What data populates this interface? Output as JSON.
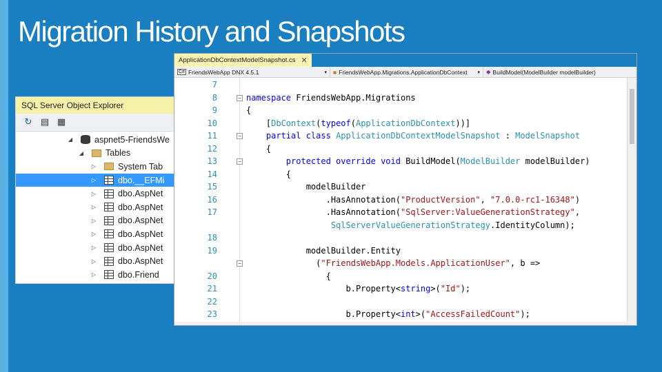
{
  "slide": {
    "title": "Migration History and Snapshots"
  },
  "object_explorer": {
    "title": "SQL Server Object Explorer",
    "toolbar_icons": [
      "refresh-icon",
      "filter-icon",
      "new-query-icon"
    ],
    "tree": [
      {
        "label": "aspnet5-FriendsWe",
        "icon": "database-icon",
        "expanded": true,
        "selected": false
      },
      {
        "label": "Tables",
        "icon": "folder-icon",
        "expanded": true,
        "selected": false
      },
      {
        "label": "System Tab",
        "icon": "folder-icon",
        "expanded": false,
        "selected": false
      },
      {
        "label": "dbo.__EFMi",
        "icon": "table-icon",
        "expanded": false,
        "selected": true
      },
      {
        "label": "dbo.AspNet",
        "icon": "table-icon",
        "expanded": false,
        "selected": false
      },
      {
        "label": "dbo.AspNet",
        "icon": "table-icon",
        "expanded": false,
        "selected": false
      },
      {
        "label": "dbo.AspNet",
        "icon": "table-icon",
        "expanded": false,
        "selected": false
      },
      {
        "label": "dbo.AspNet",
        "icon": "table-icon",
        "expanded": false,
        "selected": false
      },
      {
        "label": "dbo.AspNet",
        "icon": "table-icon",
        "expanded": false,
        "selected": false
      },
      {
        "label": "dbo.AspNet",
        "icon": "table-icon",
        "expanded": false,
        "selected": false
      },
      {
        "label": "dbo.Friend",
        "icon": "table-icon",
        "expanded": false,
        "selected": false
      }
    ]
  },
  "editor": {
    "tab_label": "ApplicationDbContextModelSnapshot.cs",
    "nav": {
      "project": "FriendsWebApp DNX 4.5.1",
      "class": "FriendsWebApp.Migrations.ApplicationDbContext",
      "member": "BuildModel(ModelBuilder modelBuilder)"
    },
    "code_lines": [
      {
        "num": "7",
        "fold": false,
        "wrap": false,
        "segments": []
      },
      {
        "num": "8",
        "fold": true,
        "wrap": false,
        "segments": [
          {
            "t": "namespace",
            "c": "kw"
          },
          {
            "t": " FriendsWebApp.Migrations",
            "c": ""
          }
        ]
      },
      {
        "num": "9",
        "fold": false,
        "wrap": false,
        "segments": [
          {
            "t": "{",
            "c": ""
          }
        ]
      },
      {
        "num": "10",
        "fold": false,
        "wrap": false,
        "segments": [
          {
            "t": "    [",
            "c": ""
          },
          {
            "t": "DbContext",
            "c": "ty"
          },
          {
            "t": "(",
            "c": ""
          },
          {
            "t": "typeof",
            "c": "kw"
          },
          {
            "t": "(",
            "c": ""
          },
          {
            "t": "ApplicationDbContext",
            "c": "ty"
          },
          {
            "t": "))]",
            "c": ""
          }
        ]
      },
      {
        "num": "11",
        "fold": true,
        "wrap": false,
        "segments": [
          {
            "t": "    ",
            "c": ""
          },
          {
            "t": "partial class",
            "c": "kw"
          },
          {
            "t": " ",
            "c": ""
          },
          {
            "t": "ApplicationDbContextModelSnapshot",
            "c": "ty"
          },
          {
            "t": " : ",
            "c": ""
          },
          {
            "t": "ModelSnapshot",
            "c": "ty"
          }
        ]
      },
      {
        "num": "12",
        "fold": false,
        "wrap": false,
        "segments": [
          {
            "t": "    {",
            "c": ""
          }
        ]
      },
      {
        "num": "13",
        "fold": true,
        "wrap": false,
        "segments": [
          {
            "t": "        ",
            "c": ""
          },
          {
            "t": "protected override void",
            "c": "kw"
          },
          {
            "t": " BuildModel(",
            "c": ""
          },
          {
            "t": "ModelBuilder",
            "c": "ty"
          },
          {
            "t": " modelBuilder)",
            "c": ""
          }
        ]
      },
      {
        "num": "14",
        "fold": false,
        "wrap": false,
        "segments": [
          {
            "t": "        {",
            "c": ""
          }
        ]
      },
      {
        "num": "15",
        "fold": false,
        "wrap": false,
        "segments": [
          {
            "t": "            modelBuilder",
            "c": ""
          }
        ]
      },
      {
        "num": "16",
        "fold": false,
        "wrap": false,
        "segments": [
          {
            "t": "                .HasAnnotation(",
            "c": ""
          },
          {
            "t": "\"ProductVersion\"",
            "c": "st"
          },
          {
            "t": ", ",
            "c": ""
          },
          {
            "t": "\"7.0.0-rc1-16348\"",
            "c": "st"
          },
          {
            "t": ")",
            "c": ""
          }
        ]
      },
      {
        "num": "17",
        "fold": false,
        "wrap": true,
        "segments": [
          {
            "t": "                .HasAnnotation(",
            "c": ""
          },
          {
            "t": "\"SqlServer:ValueGenerationStrategy\"",
            "c": "st"
          },
          {
            "t": ",",
            "c": ""
          }
        ]
      },
      {
        "num": "",
        "fold": false,
        "wrap": false,
        "segments": [
          {
            "t": "                 ",
            "c": ""
          },
          {
            "t": "SqlServerValueGenerationStrategy",
            "c": "ty"
          },
          {
            "t": ".IdentityColumn);",
            "c": ""
          }
        ]
      },
      {
        "num": "18",
        "fold": false,
        "wrap": false,
        "segments": []
      },
      {
        "num": "19",
        "fold": false,
        "wrap": true,
        "segments": [
          {
            "t": "            modelBuilder.Entity",
            "c": ""
          }
        ]
      },
      {
        "num": "",
        "fold": true,
        "wrap": false,
        "segments": [
          {
            "t": "              (",
            "c": ""
          },
          {
            "t": "\"FriendsWebApp.Models.ApplicationUser\"",
            "c": "st"
          },
          {
            "t": ", b =>",
            "c": ""
          }
        ]
      },
      {
        "num": "20",
        "fold": false,
        "wrap": false,
        "segments": [
          {
            "t": "                {",
            "c": ""
          }
        ]
      },
      {
        "num": "21",
        "fold": false,
        "wrap": false,
        "segments": [
          {
            "t": "                    b.Property<",
            "c": ""
          },
          {
            "t": "string",
            "c": "kw"
          },
          {
            "t": ">(",
            "c": ""
          },
          {
            "t": "\"Id\"",
            "c": "st"
          },
          {
            "t": ");",
            "c": ""
          }
        ]
      },
      {
        "num": "22",
        "fold": false,
        "wrap": false,
        "segments": []
      },
      {
        "num": "23",
        "fold": false,
        "wrap": false,
        "segments": [
          {
            "t": "                    b.Property<",
            "c": ""
          },
          {
            "t": "int",
            "c": "kw"
          },
          {
            "t": ">(",
            "c": ""
          },
          {
            "t": "\"AccessFailedCount\"",
            "c": "st"
          },
          {
            "t": ");",
            "c": ""
          }
        ]
      }
    ]
  }
}
